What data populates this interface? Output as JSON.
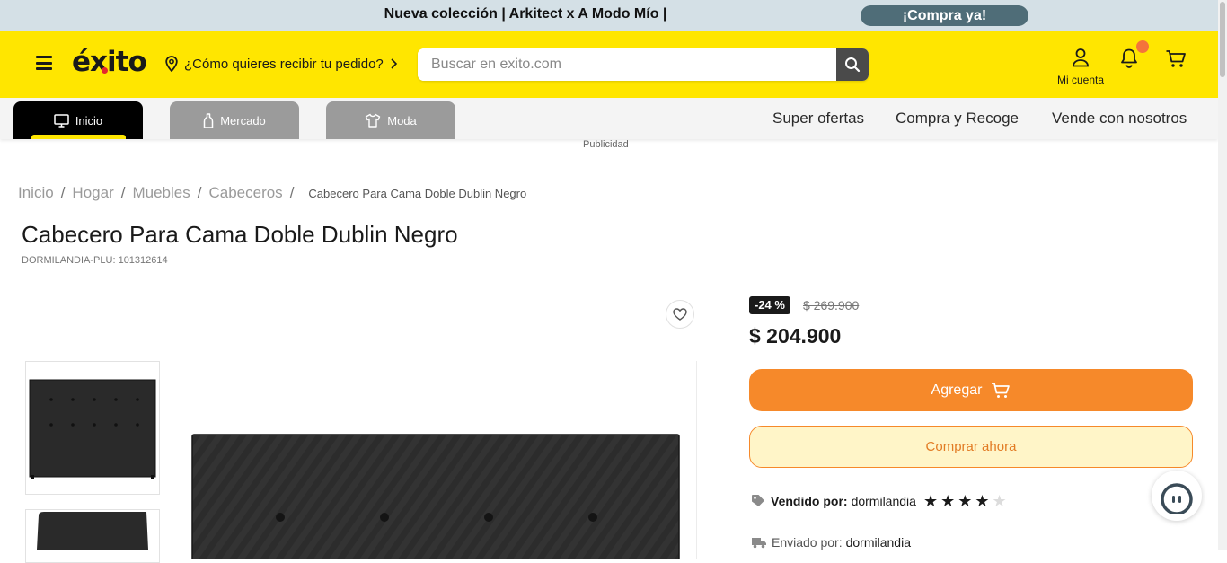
{
  "promo": {
    "text": "Nueva colección | Arkitect x A Modo Mío |",
    "button": "¡Compra ya!"
  },
  "header": {
    "logo": "éxito",
    "location_prompt": "¿Cómo quieres recibir tu pedido?",
    "search_placeholder": "Buscar en exito.com",
    "account_label": "Mi cuenta"
  },
  "category_tabs": [
    {
      "label": "Inicio",
      "icon": "monitor-icon"
    },
    {
      "label": "Mercado",
      "icon": "bottle-icon"
    },
    {
      "label": "Moda",
      "icon": "shirt-icon"
    }
  ],
  "nav_links": [
    "Super ofertas",
    "Compra y Recoge",
    "Vende con nosotros"
  ],
  "ad_label": "Publicidad",
  "breadcrumb": {
    "items": [
      "Inicio",
      "Hogar",
      "Muebles",
      "Cabeceros"
    ],
    "current": "Cabecero Para Cama Doble Dublin Negro"
  },
  "product": {
    "title": "Cabecero Para Cama Doble Dublin Negro",
    "sku": "DORMILANDIA-PLU: 101312614",
    "discount": "-24 %",
    "old_price": "$ 269.900",
    "price": "$ 204.900",
    "add_button": "Agregar",
    "buy_button": "Comprar ahora",
    "seller_label": "Vendido por:",
    "seller_name": "dormilandia",
    "rating": 4,
    "rating_max": 5,
    "shipper_label": "Enviado por:",
    "shipper_name": "dormilandia"
  },
  "colors": {
    "brand_yellow": "#ffe600",
    "accent_orange": "#f6892a",
    "promo_bg": "#d4e0e6"
  }
}
